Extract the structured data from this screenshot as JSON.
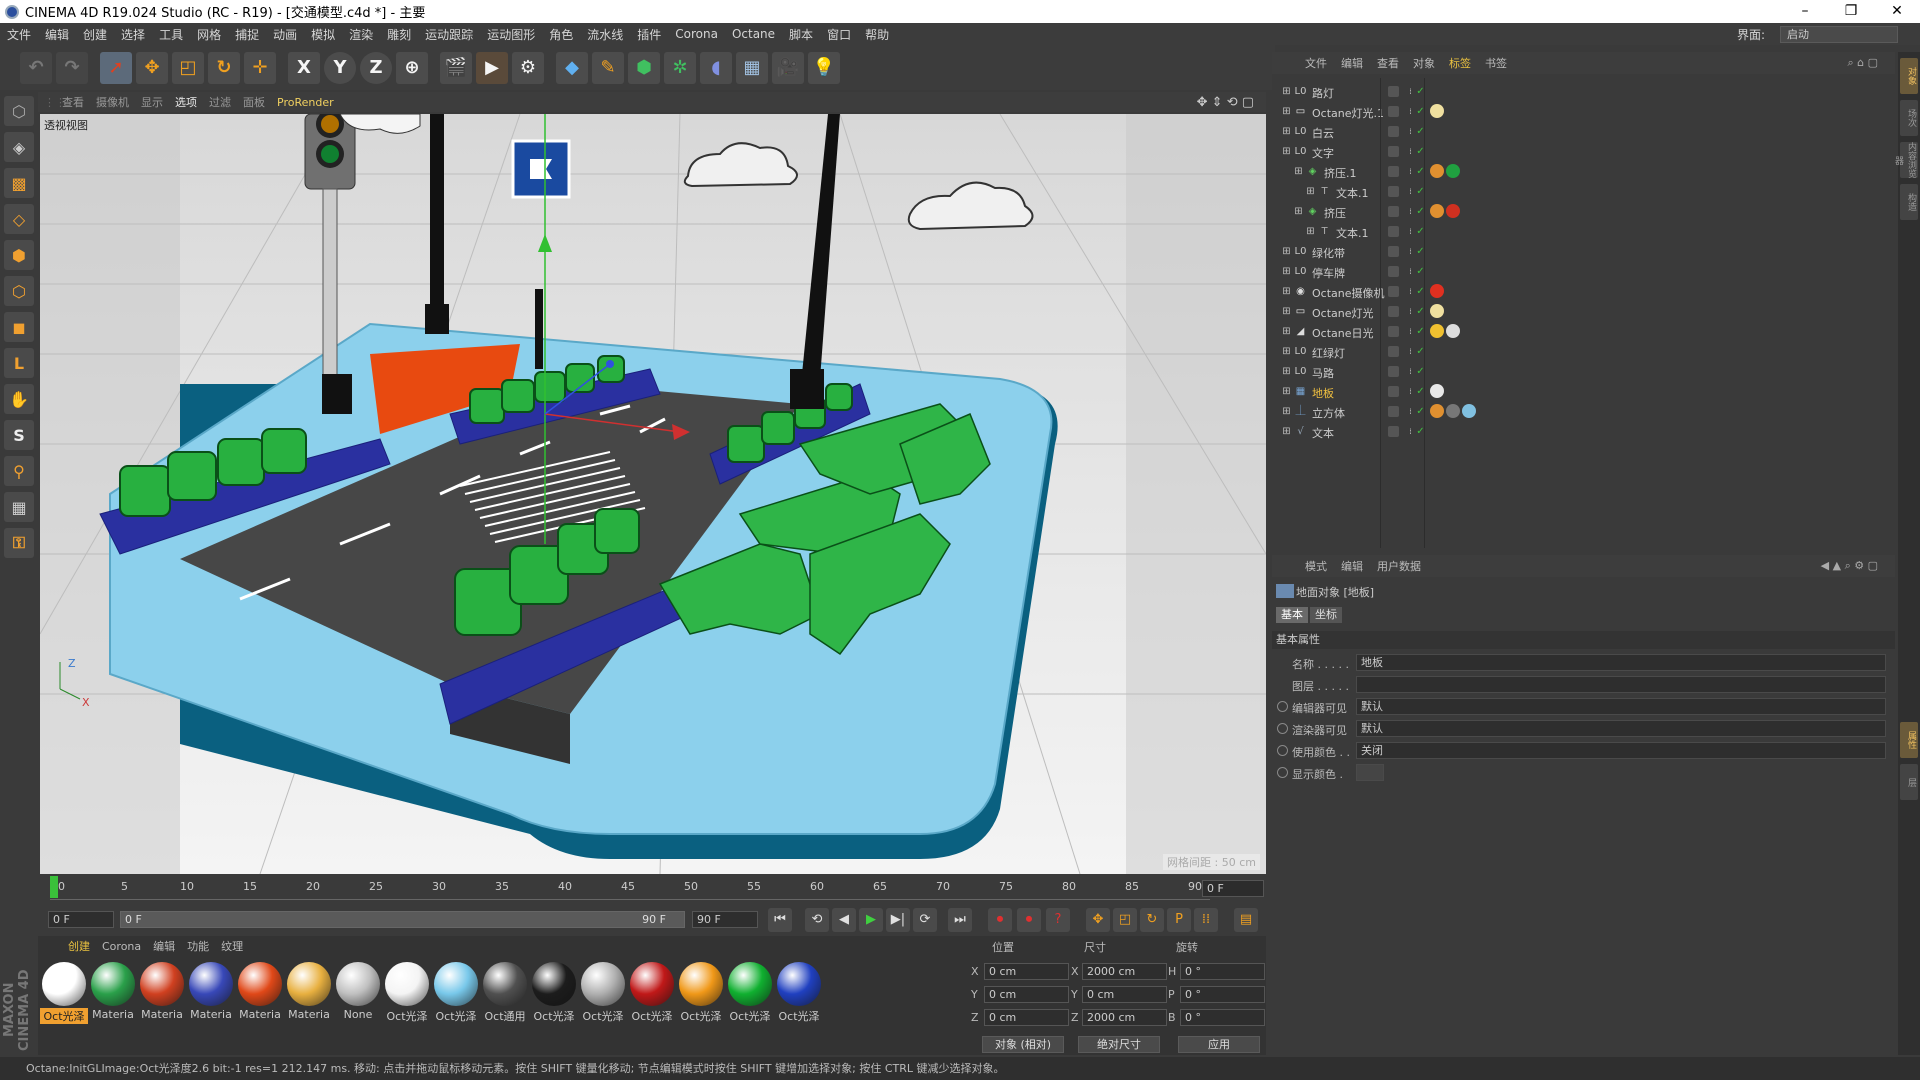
{
  "window": {
    "title": "CINEMA 4D R19.024 Studio (RC - R19) - [交通模型.c4d *] - 主要",
    "controls": [
      "–",
      "❐",
      "✕"
    ]
  },
  "menu": {
    "items": [
      "文件",
      "编辑",
      "创建",
      "选择",
      "工具",
      "网格",
      "捕捉",
      "动画",
      "模拟",
      "渲染",
      "雕刻",
      "运动跟踪",
      "运动图形",
      "角色",
      "流水线",
      "插件",
      "Corona",
      "Octane",
      "脚本",
      "窗口",
      "帮助"
    ],
    "layout_label": "界面:",
    "layout_value": "启动"
  },
  "toolbar": {
    "icons": [
      "undo-icon",
      "redo-icon",
      "select-arrow-icon",
      "move-icon",
      "scale-icon",
      "rotate-icon",
      "transform-icon",
      "x-axis-icon",
      "y-axis-icon",
      "z-axis-icon",
      "world-coord-icon",
      "render-view-icon",
      "render-picture-icon",
      "render-settings-icon",
      "cube-icon",
      "pen-icon",
      "subdivision-icon",
      "cloner-icon",
      "deformer-icon",
      "floor-icon",
      "camera-icon",
      "light-icon"
    ],
    "axis_labels": [
      "X",
      "Y",
      "Z"
    ]
  },
  "viewport": {
    "menu": [
      "查看",
      "摄像机",
      "显示",
      "选项",
      "过滤",
      "面板",
      "ProRender"
    ],
    "active_menu": "选项",
    "label": "透视视图",
    "grid_info": "网格间距 : 50 cm",
    "axis": {
      "z": "Z",
      "x": "X"
    }
  },
  "timeline": {
    "ticks": [
      "0",
      "5",
      "10",
      "15",
      "20",
      "25",
      "30",
      "35",
      "40",
      "45",
      "50",
      "55",
      "60",
      "65",
      "70",
      "75",
      "80",
      "85",
      "90"
    ],
    "frame_value": "0 F"
  },
  "transport": {
    "start_frame": "0 F",
    "slider_left": "0 F",
    "slider_right": "90 F",
    "end_frame": "90 F",
    "buttons": [
      "⏮",
      "⟲",
      "◀",
      "▶",
      "▶|",
      "⟳",
      "⏭"
    ]
  },
  "materials": {
    "menu": [
      "创建",
      "Corona",
      "编辑",
      "功能",
      "纹理"
    ],
    "items": [
      {
        "label": "Oct光泽",
        "color": "#ffffff",
        "selected": true
      },
      {
        "label": "Materia",
        "color": "#2aa04a"
      },
      {
        "label": "Materia",
        "color": "#d04020"
      },
      {
        "label": "Materia",
        "color": "#3848b8"
      },
      {
        "label": "Materia",
        "color": "#e04818"
      },
      {
        "label": "Materia",
        "color": "#e8b040"
      },
      {
        "label": "None",
        "color": "#c0c0c0"
      },
      {
        "label": "Oct光泽",
        "color": "#f4f4f4"
      },
      {
        "label": "Oct光泽",
        "color": "#78c8ea"
      },
      {
        "label": "Oct通用",
        "color": "#505050"
      },
      {
        "label": "Oct光泽",
        "color": "#1c1c1c"
      },
      {
        "label": "Oct光泽",
        "color": "#b0b0b0"
      },
      {
        "label": "Oct光泽",
        "color": "#c01818"
      },
      {
        "label": "Oct光泽",
        "color": "#f09818"
      },
      {
        "label": "Oct光泽",
        "color": "#10b030"
      },
      {
        "label": "Oct光泽",
        "color": "#2040c0"
      }
    ]
  },
  "coords": {
    "headers": [
      "位置",
      "尺寸",
      "旋转"
    ],
    "rows": [
      {
        "axis": "X",
        "pos": "0 cm",
        "size_axis": "X",
        "size": "2000 cm",
        "rot_axis": "H",
        "rot": "0 °"
      },
      {
        "axis": "Y",
        "pos": "0 cm",
        "size_axis": "Y",
        "size": "0 cm",
        "rot_axis": "P",
        "rot": "0 °"
      },
      {
        "axis": "Z",
        "pos": "0 cm",
        "size_axis": "Z",
        "size": "2000 cm",
        "rot_axis": "B",
        "rot": "0 °"
      }
    ],
    "mode": "对象 (相对)",
    "size_mode": "绝对尺寸",
    "apply": "应用"
  },
  "objects": {
    "menu": [
      "文件",
      "编辑",
      "查看",
      "对象",
      "标签",
      "书签"
    ],
    "active_menu": "标签",
    "items": [
      {
        "name": "路灯",
        "indent": 0,
        "icon": "null-icon",
        "tags": []
      },
      {
        "name": "Octane灯光.1",
        "indent": 0,
        "icon": "light-icon",
        "tags": [
          "#f0e0a0"
        ]
      },
      {
        "name": "白云",
        "indent": 0,
        "icon": "null-icon",
        "tags": []
      },
      {
        "name": "文字",
        "indent": 0,
        "icon": "null-icon",
        "tags": []
      },
      {
        "name": "挤压.1",
        "indent": 1,
        "icon": "extrude-icon",
        "tags": [
          "#e09030",
          "#20a040"
        ]
      },
      {
        "name": "文本.1",
        "indent": 2,
        "icon": "text-icon",
        "tags": []
      },
      {
        "name": "挤压",
        "indent": 1,
        "icon": "extrude-icon",
        "tags": [
          "#e09030",
          "#d03020"
        ]
      },
      {
        "name": "文本.1",
        "indent": 2,
        "icon": "text-icon",
        "tags": []
      },
      {
        "name": "绿化带",
        "indent": 0,
        "icon": "null-icon",
        "tags": []
      },
      {
        "name": "停车牌",
        "indent": 0,
        "icon": "null-icon",
        "tags": []
      },
      {
        "name": "Octane摄像机",
        "indent": 0,
        "icon": "camera-icon",
        "tags": [
          "#e03020"
        ]
      },
      {
        "name": "Octane灯光",
        "indent": 0,
        "icon": "light-icon",
        "tags": [
          "#f0e0a0"
        ]
      },
      {
        "name": "Octane日光",
        "indent": 0,
        "icon": "sun-icon",
        "tags": [
          "#f0c030",
          "#dddddd"
        ]
      },
      {
        "name": "红绿灯",
        "indent": 0,
        "icon": "null-icon",
        "tags": []
      },
      {
        "name": "马路",
        "indent": 0,
        "icon": "null-icon",
        "tags": []
      },
      {
        "name": "地板",
        "indent": 0,
        "icon": "floor-icon",
        "tags": [
          "#e8e8e8"
        ],
        "selected": true
      },
      {
        "name": "立方体",
        "indent": 0,
        "icon": "cube-icon",
        "tags": [
          "#e09030",
          "#777777",
          "#80c0e0"
        ]
      },
      {
        "name": "文本",
        "indent": 0,
        "icon": "spline-icon",
        "tags": []
      }
    ]
  },
  "attributes": {
    "menu": [
      "模式",
      "编辑",
      "用户数据"
    ],
    "title": "地面对象 [地板]",
    "tabs": [
      "基本",
      "坐标"
    ],
    "section": "基本属性",
    "rows": [
      {
        "label": "名称 . . . . .",
        "value": "地板",
        "radio": false
      },
      {
        "label": "图层 . . . . .",
        "value": "",
        "radio": false
      },
      {
        "label": "编辑器可见",
        "value": "默认",
        "radio": true
      },
      {
        "label": "渲染器可见",
        "value": "默认",
        "radio": true
      },
      {
        "label": "使用颜色 . .",
        "value": "关闭",
        "radio": true
      },
      {
        "label": "显示颜色 .",
        "value": "",
        "radio": true
      }
    ]
  },
  "right_tabs": [
    "对象",
    "场次",
    "内容浏览器",
    "构造",
    "属性",
    "层"
  ],
  "status": "Octane:InitGLImage:Oct光泽度2.6  bit:-1 res=1 212.147 ms.      移动: 点击并拖动鼠标移动元素。按住 SHIFT 键量化移动; 节点编辑模式时按住 SHIFT 键增加选择对象; 按住 CTRL 键减少选择对象。",
  "brand": "MAXON CINEMA 4D"
}
